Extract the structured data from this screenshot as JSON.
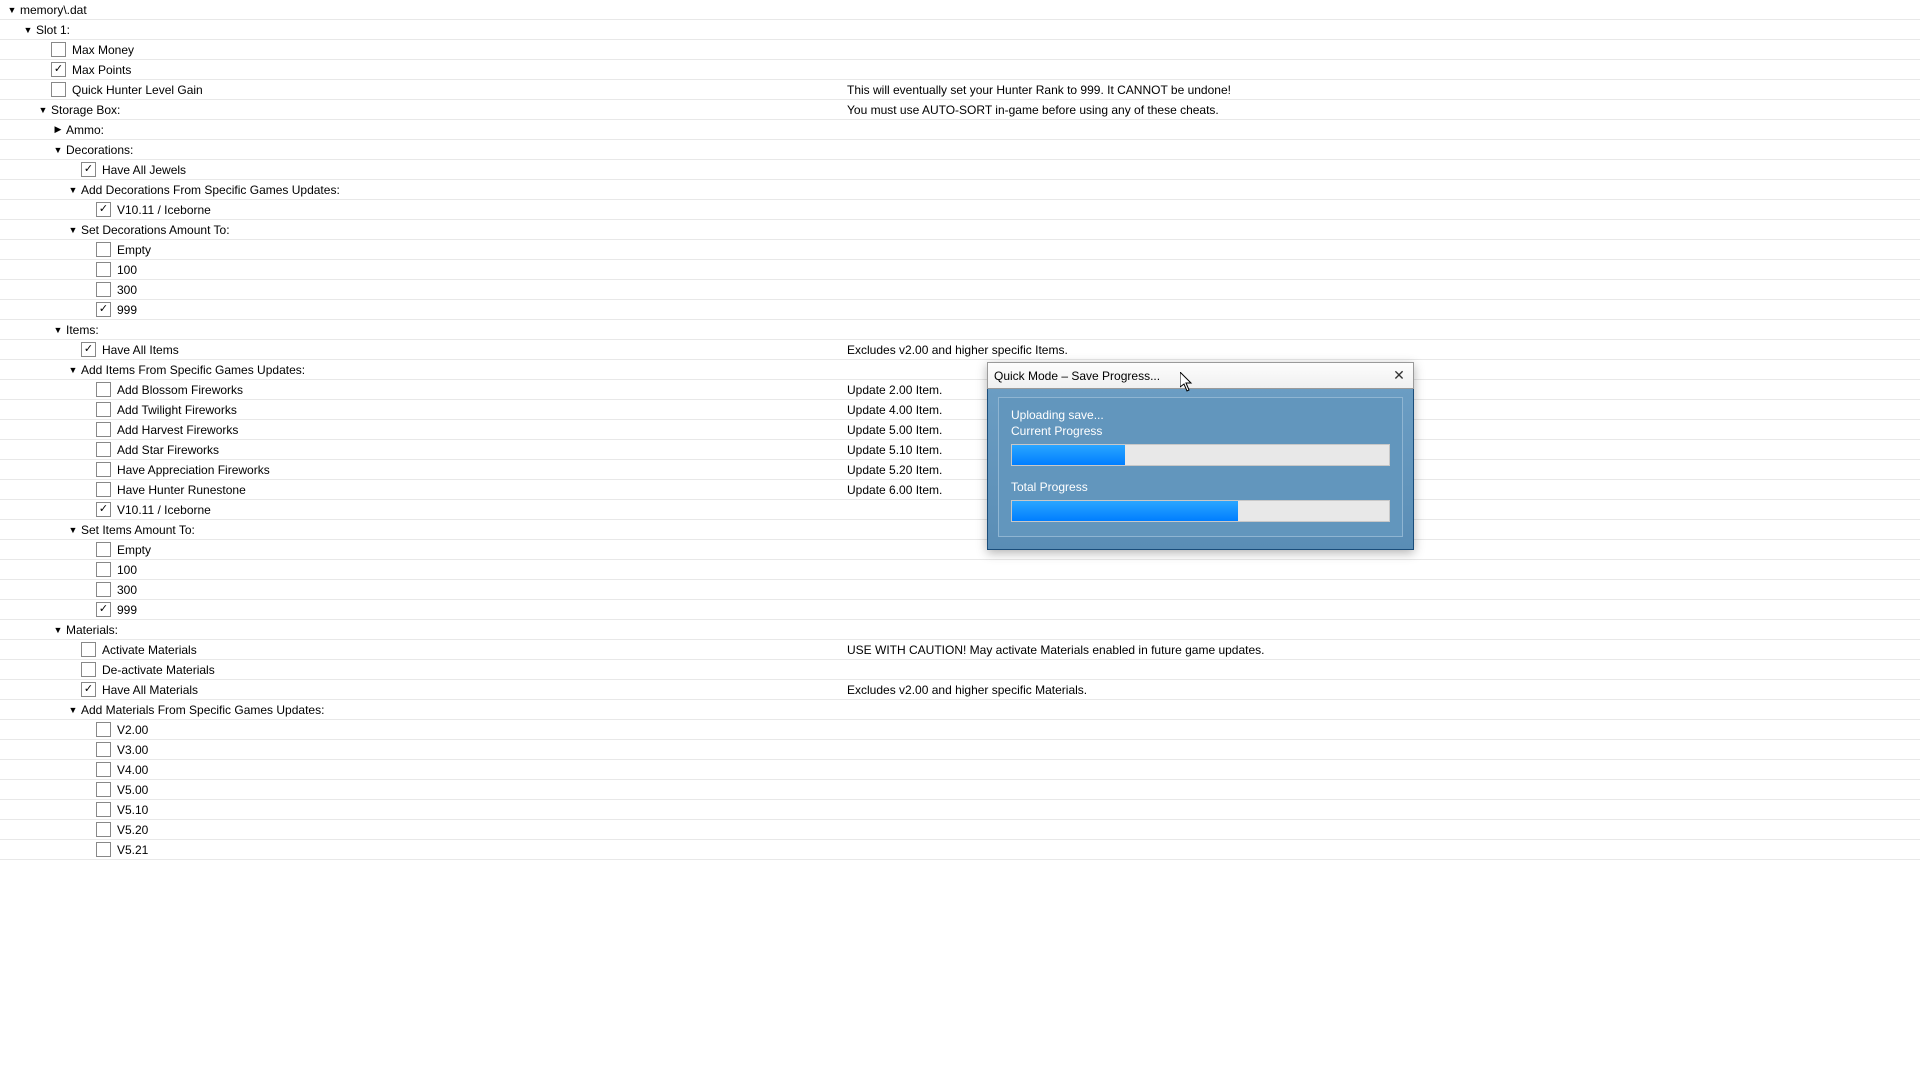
{
  "root": {
    "label": "memory\\.dat"
  },
  "slot1": {
    "label": "Slot 1:"
  },
  "maxMoney": {
    "label": "Max Money"
  },
  "maxPoints": {
    "label": "Max Points"
  },
  "quickHunter": {
    "label": "Quick Hunter Level Gain",
    "note": "This will eventually set your Hunter Rank to 999. It CANNOT be undone!"
  },
  "storageBox": {
    "label": "Storage Box:",
    "note": "You must use AUTO-SORT in-game before using any of these cheats."
  },
  "ammo": {
    "label": "Ammo:"
  },
  "decorations": {
    "label": "Decorations:"
  },
  "haveAllJewels": {
    "label": "Have All Jewels"
  },
  "addDecoFrom": {
    "label": "Add Decorations From Specific Games Updates:"
  },
  "decoV1011": {
    "label": "V10.11 / Iceborne"
  },
  "setDecoAmount": {
    "label": "Set Decorations Amount To:"
  },
  "decoEmpty": {
    "label": "Empty"
  },
  "deco100": {
    "label": "100"
  },
  "deco300": {
    "label": "300"
  },
  "deco999": {
    "label": "999"
  },
  "items": {
    "label": "Items:"
  },
  "haveAllItems": {
    "label": "Have All Items",
    "note": "Excludes v2.00 and higher specific Items."
  },
  "addItemsFrom": {
    "label": "Add Items From Specific Games Updates:"
  },
  "addBlossom": {
    "label": "Add Blossom Fireworks",
    "note": "Update 2.00 Item."
  },
  "addTwilight": {
    "label": "Add Twilight Fireworks",
    "note": "Update 4.00 Item."
  },
  "addHarvest": {
    "label": "Add Harvest Fireworks",
    "note": "Update 5.00 Item."
  },
  "addStar": {
    "label": "Add Star Fireworks",
    "note": "Update 5.10 Item."
  },
  "haveAppreciation": {
    "label": "Have Appreciation Fireworks",
    "note": "Update 5.20 Item."
  },
  "haveRunestone": {
    "label": "Have Hunter Runestone",
    "note": "Update 6.00 Item."
  },
  "itemV1011": {
    "label": "V10.11 / Iceborne"
  },
  "setItemsAmount": {
    "label": "Set Items Amount To:"
  },
  "itemEmpty": {
    "label": "Empty"
  },
  "item100": {
    "label": "100"
  },
  "item300": {
    "label": "300"
  },
  "item999": {
    "label": "999"
  },
  "materials": {
    "label": "Materials:"
  },
  "activateMat": {
    "label": "Activate Materials",
    "note": "USE WITH CAUTION! May activate Materials enabled in future game updates."
  },
  "deactivateMat": {
    "label": "De-activate Materials"
  },
  "haveAllMat": {
    "label": "Have All Materials",
    "note": "Excludes v2.00 and higher specific Materials."
  },
  "addMatFrom": {
    "label": "Add Materials From Specific Games Updates:"
  },
  "matV200": {
    "label": "V2.00"
  },
  "matV300": {
    "label": "V3.00"
  },
  "matV400": {
    "label": "V4.00"
  },
  "matV500": {
    "label": "V5.00"
  },
  "matV510": {
    "label": "V5.10"
  },
  "matV520": {
    "label": "V5.20"
  },
  "matV521": {
    "label": "V5.21"
  },
  "dialog": {
    "title": "Quick Mode – Save Progress...",
    "status": "Uploading save...",
    "currentLabel": "Current Progress",
    "totalLabel": "Total Progress"
  }
}
